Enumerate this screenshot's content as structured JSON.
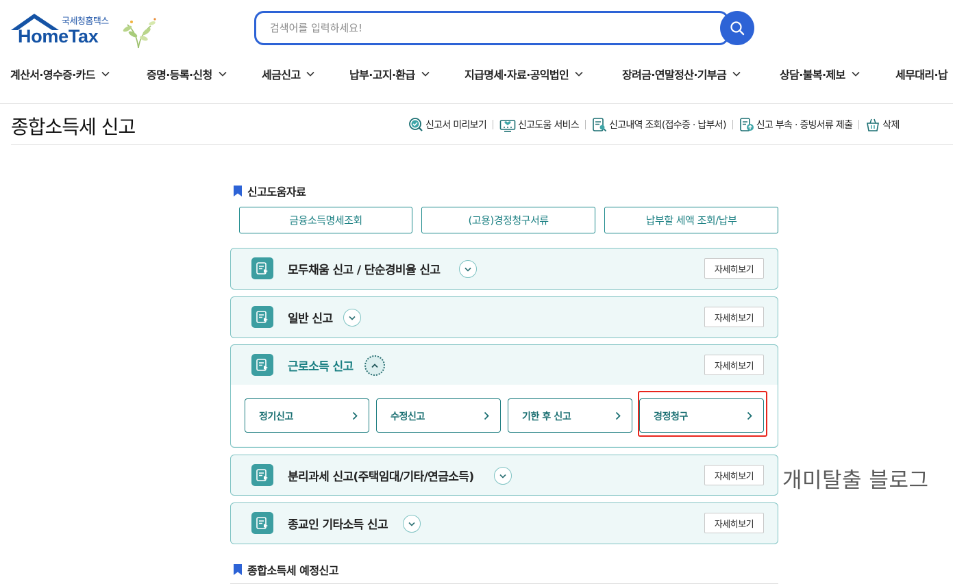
{
  "header": {
    "logo_sub": "국세청홈택스",
    "logo_main": "HomeTax",
    "search_placeholder": "검색어를 입력하세요!"
  },
  "gnb": [
    {
      "label": "계산서·영수증·카드"
    },
    {
      "label": "증명·등록·신청"
    },
    {
      "label": "세금신고"
    },
    {
      "label": "납부·고지·환급"
    },
    {
      "label": "지급명세·자료·공익법인"
    },
    {
      "label": "장려금·연말정산·기부금"
    },
    {
      "label": "상담·불복·제보"
    },
    {
      "label": "세무대리·납"
    }
  ],
  "page": {
    "title": "종합소득세 신고",
    "utils": [
      {
        "label": "신고서 미리보기",
        "icon": "magnify-check-icon"
      },
      {
        "label": "신고도움 서비스",
        "icon": "monitor-heart-icon"
      },
      {
        "label": "신고내역 조회(접수증 · 납부서)",
        "icon": "doc-search-icon"
      },
      {
        "label": "신고 부속 · 증빙서류 제출",
        "icon": "doc-upload-icon"
      },
      {
        "label": "삭제",
        "icon": "basket-icon"
      }
    ]
  },
  "help": {
    "heading": "신고도움자료",
    "buttons": [
      "금융소득명세조회",
      "(고용)경정청구서류",
      "납부할 세액 조회/납부"
    ]
  },
  "accordions": [
    {
      "title": "모두채움 신고 / 단순경비율 신고",
      "detail": "자세히보기",
      "open": false
    },
    {
      "title": "일반 신고",
      "detail": "자세히보기",
      "open": false
    },
    {
      "title": "근로소득 신고",
      "detail": "자세히보기",
      "open": true,
      "options": [
        "정기신고",
        "수정신고",
        "기한 후 신고",
        "경정청구"
      ]
    },
    {
      "title": "분리과세 신고(주택임대/기타/연금소득)",
      "detail": "자세히보기",
      "open": false
    },
    {
      "title": "종교인 기타소득 신고",
      "detail": "자세히보기",
      "open": false
    }
  ],
  "section2": {
    "heading": "종합소득세 예정신고"
  },
  "watermark": "개미탈출 블로그",
  "colors": {
    "brand": "#2d63d6",
    "teal": "#1a7f82",
    "highlight": "#e8251c"
  }
}
